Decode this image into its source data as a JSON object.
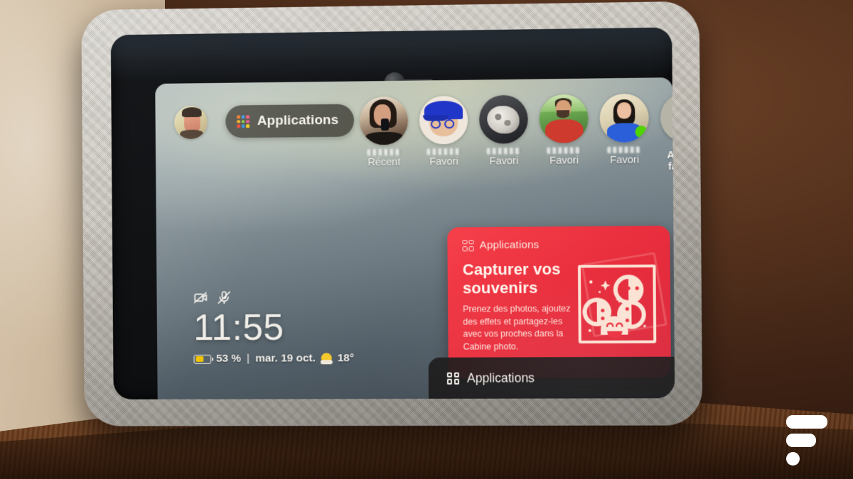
{
  "scene": {
    "device_name": "meta-portal-smart-display",
    "watermark": "frandroid-logo"
  },
  "screen": {
    "profile_avatar_alt": "profile-avatar",
    "apps_pill": {
      "label": "Applications",
      "icon": "apps-grid-icon",
      "icon_colors": [
        "#f07b2e",
        "#3ba0e8",
        "#f05a7a",
        "#f0b429",
        "#8dd13f",
        "#e8578c",
        "#e84b3c",
        "#2f9be8",
        "#f0c81e"
      ]
    },
    "contacts": [
      {
        "name_hidden": true,
        "caption": "Récent",
        "avatar": "contact-photo-selfie",
        "online": false
      },
      {
        "name_hidden": true,
        "caption": "Favori",
        "avatar": "contact-memoji-cap",
        "online": false
      },
      {
        "name_hidden": true,
        "caption": "Favori",
        "avatar": "contact-photo-dog",
        "online": false
      },
      {
        "name_hidden": true,
        "caption": "Favori",
        "avatar": "contact-photo-man-red-shirt",
        "online": false
      },
      {
        "name_hidden": true,
        "caption": "Favori",
        "avatar": "contact-photo-woman-blue-shirt",
        "online": true
      },
      {
        "name_hidden": false,
        "caption": "Ajouter aux favoris",
        "caption_line1": "Ajouter",
        "caption_line2": "favoris",
        "avatar": "add-favorite-icon",
        "online": false
      }
    ],
    "clock": {
      "time": "11:55",
      "camera_muted_icon": "camera-off-icon",
      "mic_muted_icon": "mic-off-icon",
      "battery_percent": "53 %",
      "separator": "|",
      "date": "mar. 19 oct.",
      "weather_icon": "sun-icon",
      "temperature": "18°"
    },
    "promo_card": {
      "header_icon": "apps-grid-outline-icon",
      "header_label": "Applications",
      "title": "Capturer vos souvenirs",
      "description": "Prenez des photos, ajoutez des effets et partagez-les avec vos proches dans la Cabine photo.",
      "illustration": "photo-booth-faces-illustration",
      "accent_color": "#ea2f3e"
    },
    "dock": {
      "icon": "apps-grid-outline-icon",
      "label": "Applications"
    }
  },
  "hardware": {
    "camera_shutter": "camera-shutter-slider",
    "status_led": "orange-status-led",
    "ambient_sensor": "ambient-light-sensor",
    "mic_hole": "microphone-hole"
  }
}
